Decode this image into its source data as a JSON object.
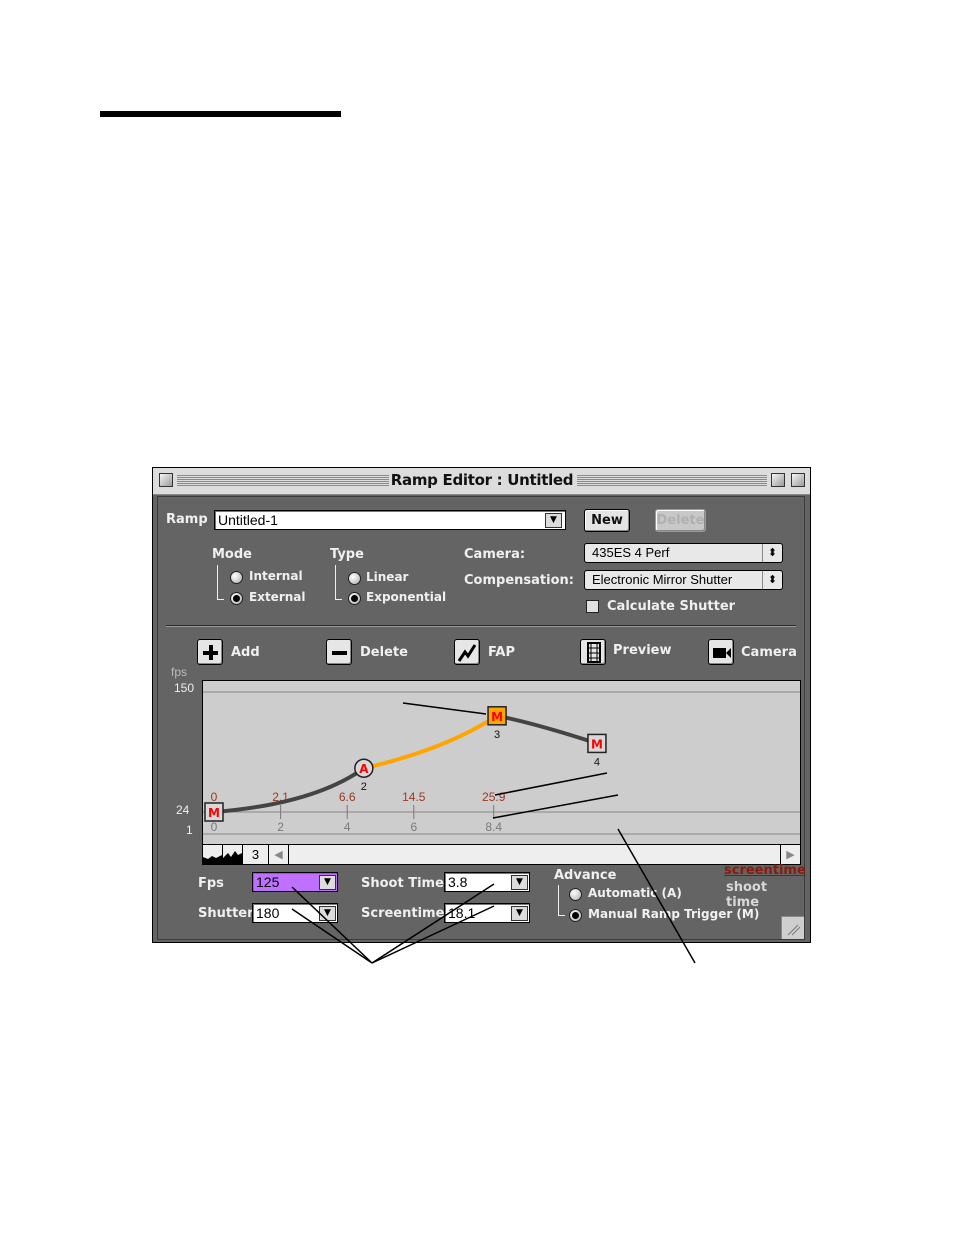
{
  "window": {
    "title": "Ramp Editor : Untitled"
  },
  "ramp": {
    "label": "Ramp",
    "value": "Untitled-1",
    "new_label": "New",
    "delete_label": "Delete"
  },
  "mode": {
    "label": "Mode",
    "options": [
      "Internal",
      "External"
    ],
    "selected": "External"
  },
  "type": {
    "label": "Type",
    "options": [
      "Linear",
      "Exponential"
    ],
    "selected": "Exponential"
  },
  "camera": {
    "label": "Camera:",
    "value": "435ES 4 Perf"
  },
  "compensation": {
    "label": "Compensation:",
    "value": "Electronic Mirror Shutter"
  },
  "calculate_shutter": {
    "label": "Calculate Shutter",
    "checked": false
  },
  "toolbar": {
    "add": "Add",
    "delete": "Delete",
    "fap": "FAP",
    "preview": "Preview",
    "camera": "Camera"
  },
  "graph": {
    "y_unit": "fps",
    "y_ticks": [
      "150",
      "24",
      "1"
    ],
    "screentime_labels": [
      "0",
      "2.1",
      "6.6",
      "14.5",
      "25.9"
    ],
    "shoottime_labels": [
      "0",
      "2",
      "4",
      "6",
      "8.4"
    ],
    "scroll_value": "3"
  },
  "chart_data": {
    "type": "line",
    "ylabel": "fps",
    "ylim": [
      1,
      150
    ],
    "y_ticks": [
      150,
      24,
      1
    ],
    "x_shoot_time": [
      0,
      2,
      4,
      6,
      8.4
    ],
    "x_screen_time": [
      0,
      2.1,
      6.6,
      14.5,
      25.9
    ],
    "keyframes": [
      {
        "id": "1",
        "kind": "M",
        "shoot_time": 0,
        "fps": 24
      },
      {
        "id": "2",
        "kind": "A",
        "shoot_time": 4.5,
        "fps": 70
      },
      {
        "id": "3",
        "kind": "M",
        "shoot_time": 8.5,
        "fps": 125,
        "selected": true
      },
      {
        "id": "4",
        "kind": "M",
        "shoot_time": 11.5,
        "fps": 96
      }
    ],
    "highlighted_segment": [
      "2",
      "3"
    ],
    "colors": {
      "curve": "#444444",
      "highlight": "#ffa500",
      "marker_text": "#ff0000"
    }
  },
  "fields": {
    "fps_label": "Fps",
    "fps_value": "125",
    "shutter_label": "Shutter",
    "shutter_value": "180",
    "shoot_time_label": "Shoot Time",
    "shoot_time_value": "3.8",
    "screentime_label": "Screentime",
    "screentime_value": "18.1"
  },
  "advance": {
    "label": "Advance",
    "options": [
      "Automatic (A)",
      "Manual Ramp Trigger (M)"
    ],
    "selected": "Manual Ramp Trigger (M)"
  },
  "legend": {
    "screentime": "screentime",
    "shoot_time": "shoot time"
  },
  "colors": {
    "fps_field_highlight": "#c070ff",
    "panel_bg": "#646464",
    "screentime_label": "#8b1a0a"
  }
}
